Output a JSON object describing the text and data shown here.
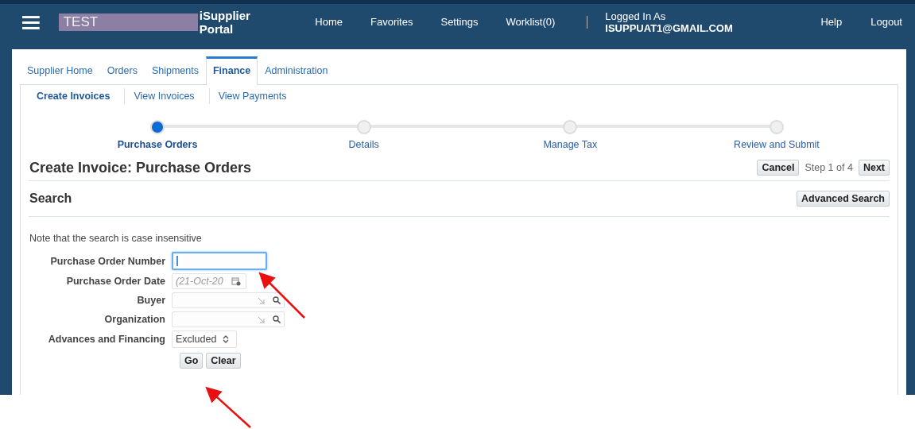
{
  "header": {
    "brand_box": "TEST",
    "app_title": "iSupplier Portal",
    "nav": [
      "Home",
      "Favorites",
      "Settings",
      "Worklist(0)"
    ],
    "logged_in_label": "Logged In As",
    "user": "ISUPPUAT1@GMAIL.COM",
    "links": [
      "Help",
      "Logout"
    ]
  },
  "tabs": [
    {
      "label": "Supplier Home",
      "selected": false
    },
    {
      "label": "Orders",
      "selected": false
    },
    {
      "label": "Shipments",
      "selected": false
    },
    {
      "label": "Finance",
      "selected": true
    },
    {
      "label": "Administration",
      "selected": false
    }
  ],
  "subtabs": [
    {
      "label": "Create Invoices",
      "selected": true
    },
    {
      "label": "View Invoices",
      "selected": false
    },
    {
      "label": "View Payments",
      "selected": false
    }
  ],
  "steps": [
    {
      "label": "Purchase Orders",
      "selected": true
    },
    {
      "label": "Details",
      "selected": false
    },
    {
      "label": "Manage Tax",
      "selected": false
    },
    {
      "label": "Review and Submit",
      "selected": false
    }
  ],
  "page": {
    "title": "Create Invoice: Purchase Orders",
    "cancel": "Cancel",
    "step_text": "Step 1 of 4",
    "next": "Next"
  },
  "search": {
    "title": "Search",
    "advanced": "Advanced Search",
    "note": "Note that the search is case insensitive",
    "fields": [
      {
        "label": "Purchase Order Number",
        "kind": "text",
        "focused": true
      },
      {
        "label": "Purchase Order Date",
        "kind": "date",
        "placeholder": "(21-Oct-20",
        "focused": false
      },
      {
        "label": "Buyer",
        "kind": "lov",
        "focused": false
      },
      {
        "label": "Organization",
        "kind": "lov",
        "focused": false
      },
      {
        "label": "Advances and Financing",
        "kind": "select",
        "value": "Excluded",
        "focused": false
      }
    ],
    "buttons": [
      "Go",
      "Clear"
    ]
  }
}
